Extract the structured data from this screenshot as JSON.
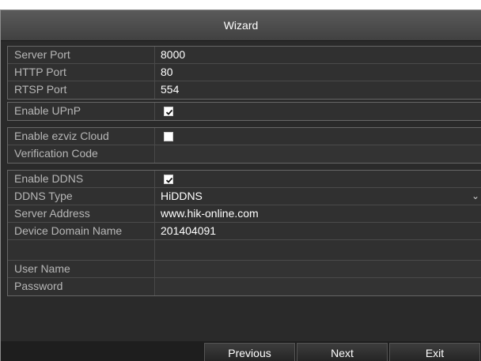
{
  "window": {
    "title": "Wizard"
  },
  "network": {
    "server_port": {
      "label": "Server Port",
      "value": "8000"
    },
    "http_port": {
      "label": "HTTP Port",
      "value": "80"
    },
    "rtsp_port": {
      "label": "RTSP Port",
      "value": "554"
    }
  },
  "upnp": {
    "label": "Enable UPnP",
    "checked": true
  },
  "ezviz": {
    "enable_label": "Enable ezviz Cloud",
    "checked": false,
    "verification_label": "Verification Code",
    "verification_value": ""
  },
  "ddns": {
    "enable_label": "Enable DDNS",
    "checked": true,
    "type_label": "DDNS Type",
    "type_value": "HiDDNS",
    "server_label": "Server Address",
    "server_value": "www.hik-online.com",
    "domain_label": "Device Domain Name",
    "domain_value": "201404091",
    "user_label": "User Name",
    "user_value": "",
    "password_label": "Password",
    "password_value": ""
  },
  "footer": {
    "previous": "Previous",
    "next": "Next",
    "exit": "Exit"
  },
  "icons": {
    "check": "check-icon",
    "dropdown": "chevron-down-icon"
  }
}
